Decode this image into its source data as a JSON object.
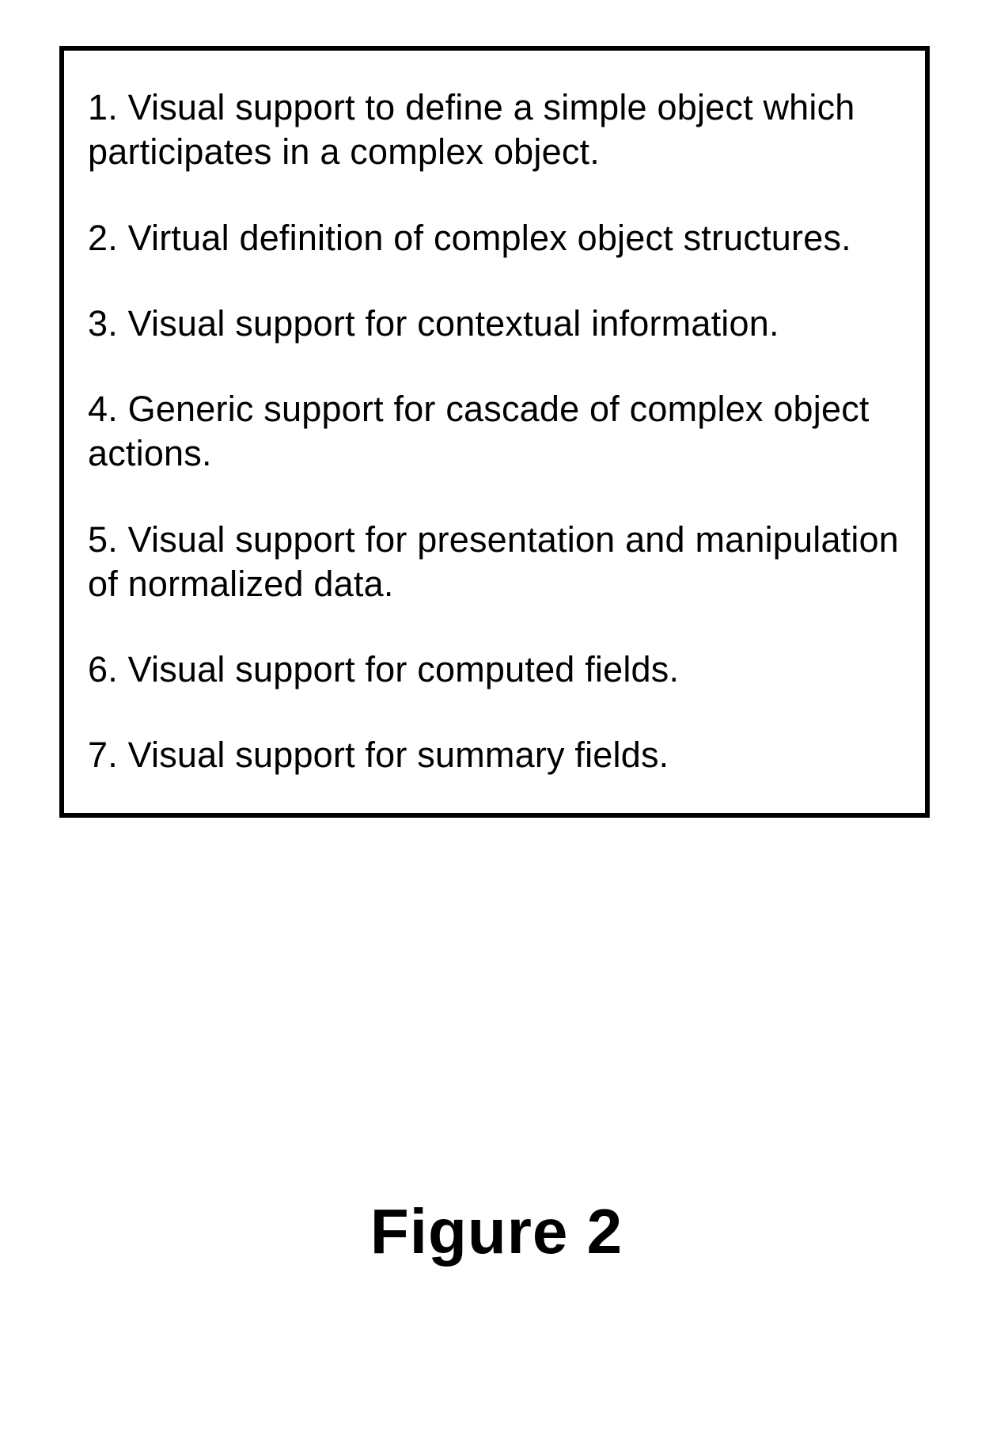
{
  "items": [
    "1. Visual support to define a simple object which participates in a complex object.",
    "2. Virtual definition of complex object structures.",
    "3. Visual support for contextual information.",
    "4. Generic support for cascade of complex object actions.",
    "5. Visual support for presentation and manipulation of normalized data.",
    "6. Visual support for computed fields.",
    "7. Visual support for summary fields."
  ],
  "figure_label": "Figure 2"
}
